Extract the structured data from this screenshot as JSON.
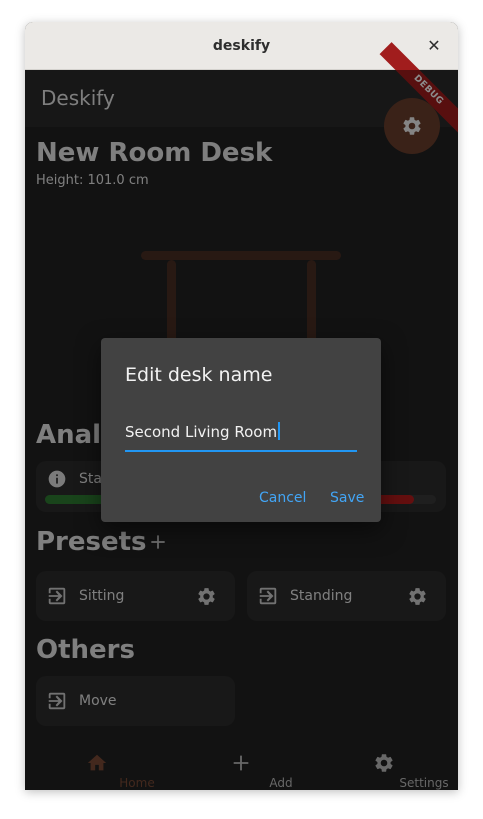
{
  "window": {
    "title": "deskify",
    "close_glyph": "✕"
  },
  "appbar": {
    "title": "Deskify",
    "debug_banner": "DEBUG",
    "fab_icon": "gear-icon"
  },
  "desk": {
    "name": "New Room Desk",
    "height_text": "Height: 101.0 cm"
  },
  "analytics": {
    "heading": "Analytics",
    "card_label": "Standing",
    "info_icon": "info-icon",
    "progress": {
      "sitting_fraction": 0.5,
      "standing_fraction": 0.5
    }
  },
  "presets": {
    "heading": "Presets",
    "add_icon": "plus-icon",
    "items": [
      {
        "label": "Sitting",
        "icon": "login-icon",
        "settings_icon": "gear-icon"
      },
      {
        "label": "Standing",
        "icon": "login-icon",
        "settings_icon": "gear-icon"
      }
    ]
  },
  "others": {
    "heading": "Others",
    "items": [
      {
        "label": "Move",
        "icon": "login-icon"
      }
    ]
  },
  "bottom_nav": [
    {
      "label": "Home",
      "icon": "home-icon",
      "active": true
    },
    {
      "label": "Add",
      "icon": "plus-icon",
      "active": false
    },
    {
      "label": "Settings",
      "icon": "gear-icon",
      "active": false
    }
  ],
  "dialog": {
    "title": "Edit desk name",
    "value": "Second Living Room",
    "cancel_label": "Cancel",
    "save_label": "Save"
  },
  "colors": {
    "accent": "#2196f3",
    "brand": "#6a3e2c",
    "green": "#2e7d32",
    "red": "#b71c1c"
  }
}
